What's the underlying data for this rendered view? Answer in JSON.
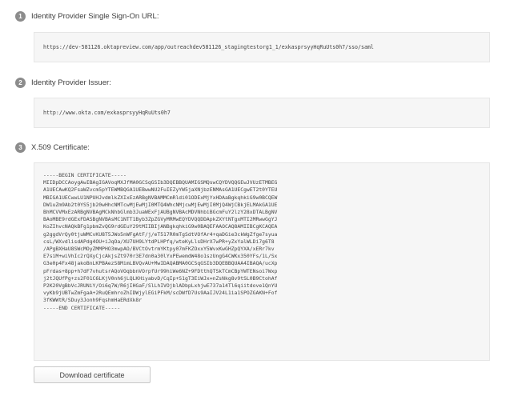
{
  "steps": [
    {
      "number": "1",
      "title": "Identity Provider Single Sign-On URL:",
      "value": "https://dev-581126.oktapreview.com/app/outreachdev581126_stagingtestorg1_1/exkasprsyyHqRuUts0h7/sso/saml"
    },
    {
      "number": "2",
      "title": "Identity Provider Issuer:",
      "value": "http://www.okta.com/exkasprsyyHqRuUts0h7"
    },
    {
      "number": "3",
      "title": "X.509 Certificate:",
      "value": "-----BEGIN CERTIFICATE-----\nMIIDpDCCAoygAwIBAgIGAVoqMXJfMA0GCSqGSIb3DQEBBQUAMIGSMQswCQYDVQQGEwJVUzETMBEG\nA1UECAwKQ2FsaWZvcm5pYTEWMBQGA1UEBwwNU2FuIEZyYW5jaXNjbzENMAsGA1UECgwET2t0YTEU\nMBIGA1UECwwLU1NPUHJvdmlkZXIxEzARBgNVBAMMCmRldi01ODExMjYxHDAaBgkqhkiG9w0BCQEW\nDW1uZm9Ab2t0YS5jb20wHhcNMTcwMjEwMjI0MTQ4WhcNMjcwMjEwMjI0MjQ4WjCBkjELMAkGA1UE\nBhMCVVMxEzARBgNVBAgMCkNhbGlmb3JuaWExFjAUBgNVBAcMDVNhbiBGcmFuY2lzY28xDTALBgNV\nBAoMBE9rdGExFDASBgNVBAsMC1NTT1Byb3ZpZGVyMRMwEQYDVQQDDApkZXYtNTgxMTI2MRwwGgYJ\nKoZIhvcNAQkBFg1pbmZvQG9rdGEuY29tMIIBIjANBgkqhkiG9w0BAQEFAAOCAQ8AMIIBCgKCAQEA\ng2ggdVrQy0tjuWMCvKU8T5JWo5nWFgAtF/j/eT517R0mTgSdtVOfAr4+qaDGie3ckWgZfge7syua\ncsL/WXvdlisdAPdg4OU+iJqOa/XU7UH9LYtdPLHPfq/wteKyLlsDHrX7wPR+yZxYalWLDi7g6T8\n/APgBXHaU8SWcMOyZMMPHO3mwpAO/BVCtOvtrmYKtpy07mFKZOxxY5WvxKwGHZpQYXA/xERr7kv\nE7siM+wiVhIc2rQXyCjcAkjsZt970r3E7dn0a30lYxPEwemdW48o1szUngG4CWKx350YFs/1L/Sx\nG3e0p4Fx48jakoBnLKPBAezS8MimLBVQvAU+MwIDAQABMA0GCSqGSIb3DQEBBQUAA4IBAQA/ucXp\npFrdas+8pp+h7dF7vhutsrAQoVOqbbnVOrpfUr99hiWe6NZ+9FDtthQTSkTCmCBpYWTENsoi7Wxp\nj2tJQUfPg+zs2F01C6LKjV0nh6jLQLKHiyabvD/CqIp+S1gT3EiWJx=nZsNkg8v9tSL0B9CtohAf\nP2K20VgBbVcJRUNiY/Oi6q7W/R6jIHGaF/SlLhIVOjblADbpLxhjwE737a14Tl6qiitdove1QnYU\nvyKb9jUBTwZmFgaA+2RuQEmhroZhIDWjylEGiPFkM/scDWfD7Us9AaIJV24L1ia1SPOZGAKN+Fof\n3fKWWtR/SDuy3Jonh9FqshmHaERdXk8r\n-----END CERTIFICATE-----"
    }
  ],
  "download_button": {
    "label": "Download certificate"
  }
}
